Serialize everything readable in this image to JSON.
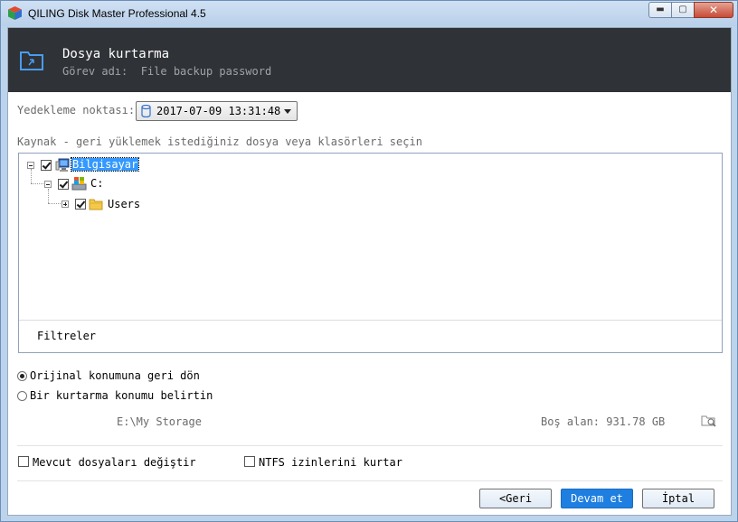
{
  "window": {
    "title": "QILING Disk Master Professional 4.5"
  },
  "header": {
    "title": "Dosya kurtarma",
    "task_label": "Görev adı:",
    "task_name": "File backup password"
  },
  "backup_point": {
    "label": "Yedekleme noktası:",
    "value": "2017-07-09 13:31:48"
  },
  "source": {
    "label": "Kaynak - geri yüklemek istediğiniz dosya veya klasörleri seçin",
    "tree": [
      {
        "label": "Bilgisayar",
        "checked": true,
        "expanded": true,
        "selected": true
      },
      {
        "label": "C:",
        "checked": true,
        "expanded": true
      },
      {
        "label": "Users",
        "checked": true,
        "expanded": false
      }
    ],
    "filters_label": "Filtreler"
  },
  "restore": {
    "option_original": "Orijinal konumuna geri dön",
    "option_custom": "Bir kurtarma konumu belirtin",
    "selected": "original",
    "path": "E:\\My Storage",
    "free_space": "Boş alan: 931.78 GB"
  },
  "options": {
    "replace_files": "Mevcut dosyaları değiştir",
    "ntfs_permissions": "NTFS izinlerini kurtar"
  },
  "buttons": {
    "back": "<Geri",
    "next": "Devam et",
    "cancel": "İptal"
  },
  "colors": {
    "header_bg": "#2f3236",
    "accent": "#1e7fe0",
    "selection": "#3399ff"
  }
}
